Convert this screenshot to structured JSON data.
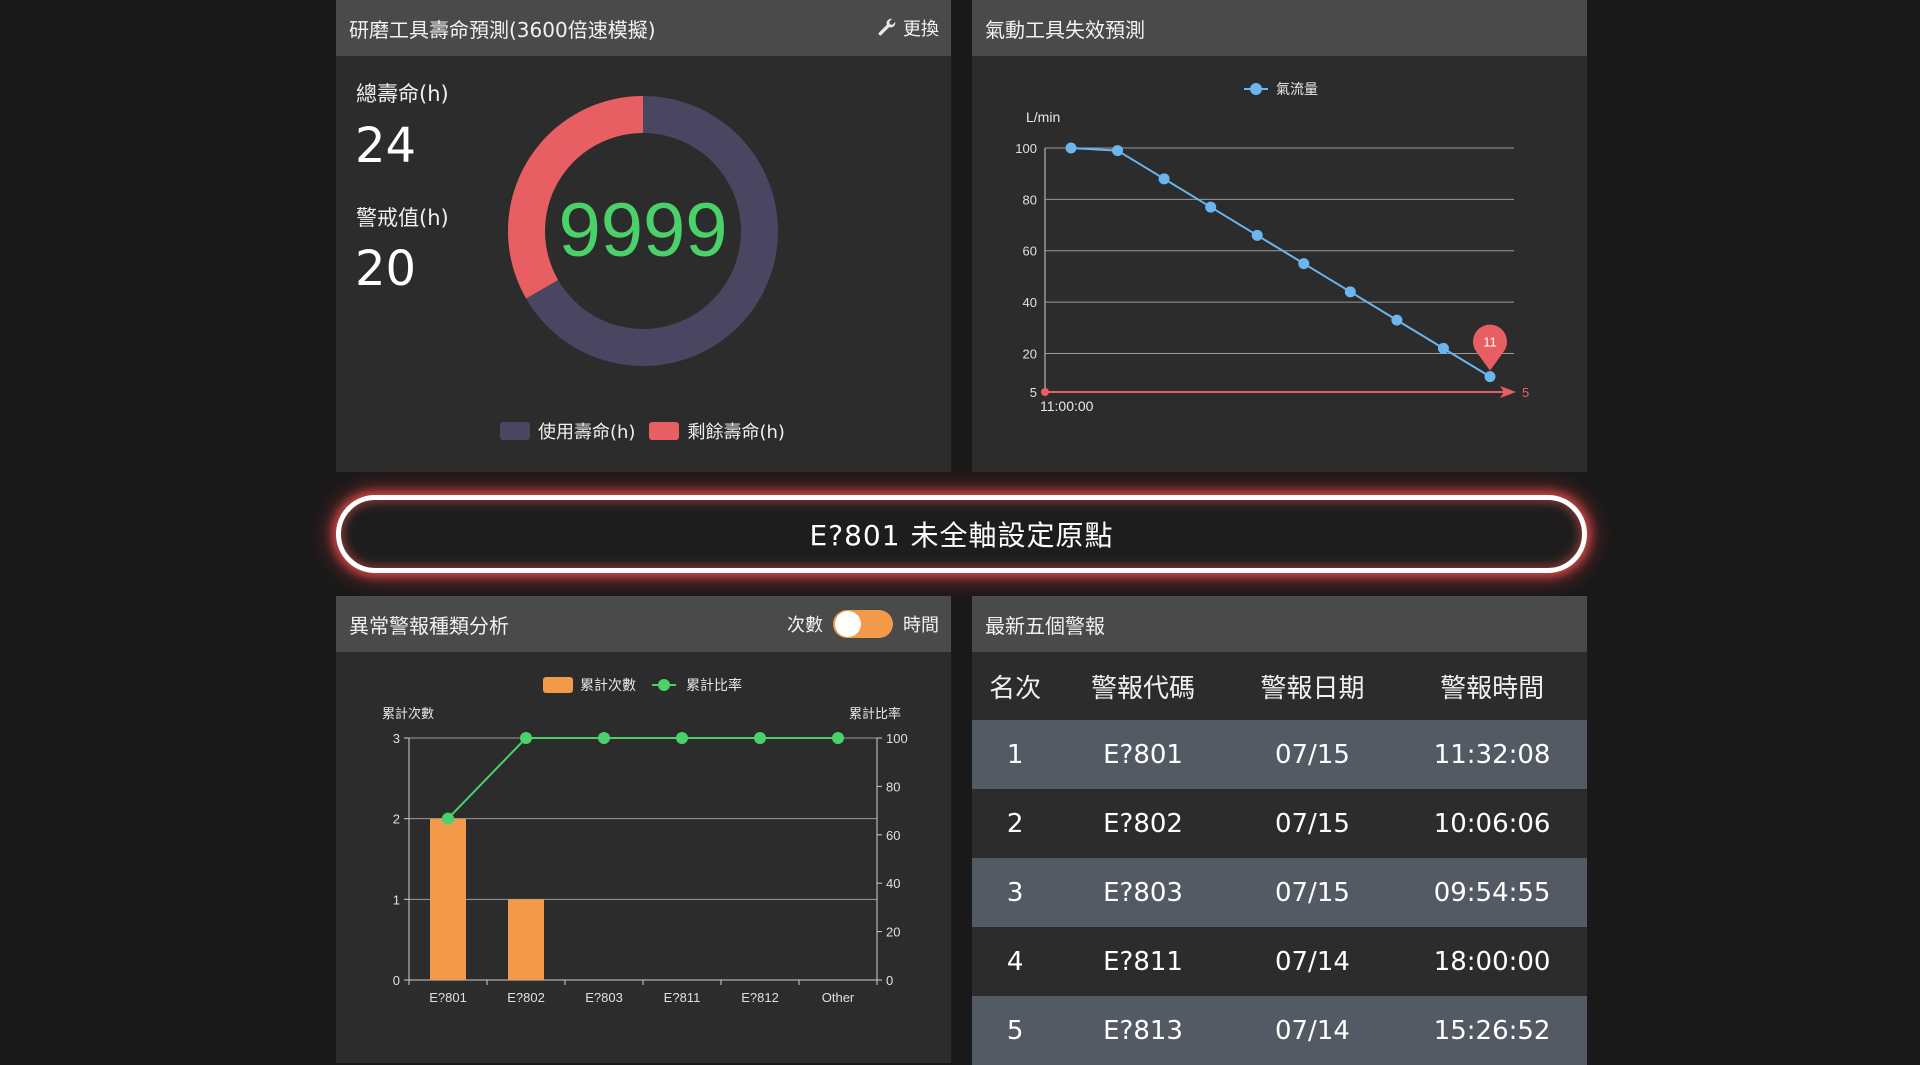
{
  "tool_life": {
    "title": "研磨工具壽命預測(3600倍速模擬)",
    "replace_label": "更換",
    "replace_icon": "wrench-icon",
    "total_label": "總壽命(h)",
    "total_value": "24",
    "alert_label": "警戒值(h)",
    "alert_value": "20",
    "center_value": "9999",
    "legend_used": "使用壽命(h)",
    "legend_remaining": "剩餘壽命(h)",
    "colors": {
      "used": "#4a4560",
      "remaining": "#e85f63",
      "center": "#4bd16a"
    },
    "chart_data": {
      "type": "pie",
      "labels": [
        "使用壽命(h)",
        "剩餘壽命(h)"
      ],
      "values": [
        16,
        8
      ]
    }
  },
  "pneumatic": {
    "title": "氣動工具失效預測",
    "legend": "氣流量",
    "y_unit": "L/min",
    "x_start_label": "11:00:00",
    "threshold_label": "5",
    "threshold_end_label": "5",
    "marker_value": "11",
    "chart_data": {
      "type": "line",
      "series": [
        {
          "name": "氣流量",
          "values": [
            100,
            99,
            88,
            77,
            66,
            55,
            44,
            33,
            22,
            11
          ]
        }
      ],
      "ylim": [
        5,
        100
      ],
      "yticks": [
        5,
        20,
        40,
        60,
        80,
        100
      ],
      "ylabel": "L/min",
      "threshold": 5,
      "grid": true,
      "legend": "top-center"
    }
  },
  "banner": {
    "text": "E?801 未全軸設定原點"
  },
  "abnormal": {
    "title": "異常警報種類分析",
    "toggle_left": "次數",
    "toggle_right": "時間",
    "legend_count": "累計次數",
    "legend_ratio": "累計比率",
    "ylabel_left": "累計次數",
    "ylabel_right": "累計比率",
    "chart_data": {
      "type": "bar",
      "categories": [
        "E?801",
        "E?802",
        "E?803",
        "E?811",
        "E?812",
        "Other"
      ],
      "series": [
        {
          "name": "累計次數",
          "type": "bar",
          "values": [
            2,
            1,
            0,
            0,
            0,
            0
          ]
        },
        {
          "name": "累計比率",
          "type": "line",
          "values": [
            66.7,
            100,
            100,
            100,
            100,
            100
          ]
        }
      ],
      "ylim_left": [
        0,
        3
      ],
      "ylim_right": [
        0,
        100
      ],
      "yticks_left": [
        0,
        1,
        2,
        3
      ],
      "yticks_right": [
        0,
        20,
        40,
        60,
        80,
        100
      ],
      "colors": {
        "bar": "#f39a4a",
        "line": "#4bd16a"
      },
      "legend": "top-center"
    }
  },
  "latest": {
    "title": "最新五個警報",
    "headers": [
      "名次",
      "警報代碼",
      "警報日期",
      "警報時間"
    ],
    "rows": [
      [
        "1",
        "E?801",
        "07/15",
        "11:32:08"
      ],
      [
        "2",
        "E?802",
        "07/15",
        "10:06:06"
      ],
      [
        "3",
        "E?803",
        "07/15",
        "09:54:55"
      ],
      [
        "4",
        "E?811",
        "07/14",
        "18:00:00"
      ],
      [
        "5",
        "E?813",
        "07/14",
        "15:26:52"
      ]
    ]
  }
}
